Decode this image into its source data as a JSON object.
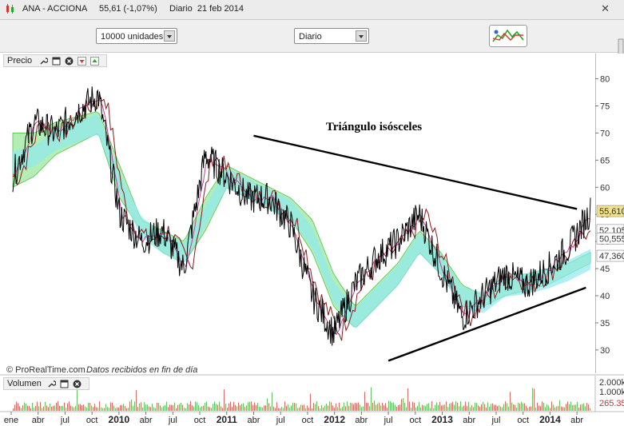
{
  "window": {
    "title": "ANA - ACCIONA     55,61 (-1,07%)     Diario  21 feb 2014"
  },
  "toolbar": {
    "units_select": "10000 unidades",
    "period_select": "Diario"
  },
  "price_panel": {
    "label": "Precio",
    "watermark_brand": "© ProRealTime.com",
    "watermark_note": "Datos recibidos en fin de día",
    "annotation": "Triángulo isósceles",
    "price_tags": [
      {
        "text": "55,610",
        "value": 55.61,
        "color": "#f3e28a"
      },
      {
        "text": "52,105",
        "value": 52.1,
        "color": "#ffffff"
      },
      {
        "text": "50,555",
        "value": 50.55,
        "color": "#ffffff"
      },
      {
        "text": "47,360",
        "value": 47.36,
        "color": "#ffffff"
      }
    ]
  },
  "volume_panel": {
    "label": "Volumen",
    "ticks": [
      "2.000k",
      "1.000k",
      "265.35"
    ]
  },
  "chart_data": {
    "type": "line",
    "title": "",
    "xlabel": "",
    "ylabel": "",
    "ylim": [
      26,
      82
    ],
    "yticks": [
      30,
      35,
      40,
      45,
      50,
      55,
      60,
      65,
      70,
      75,
      80
    ],
    "xticks": [
      {
        "label": "ene",
        "bold": false
      },
      {
        "label": "abr",
        "bold": false
      },
      {
        "label": "jul",
        "bold": false
      },
      {
        "label": "oct",
        "bold": false
      },
      {
        "label": "2010",
        "bold": true
      },
      {
        "label": "abr",
        "bold": false
      },
      {
        "label": "jul",
        "bold": false
      },
      {
        "label": "oct",
        "bold": false
      },
      {
        "label": "2011",
        "bold": true
      },
      {
        "label": "abr",
        "bold": false
      },
      {
        "label": "jul",
        "bold": false
      },
      {
        "label": "oct",
        "bold": false
      },
      {
        "label": "2012",
        "bold": true
      },
      {
        "label": "abr",
        "bold": false
      },
      {
        "label": "jul",
        "bold": false
      },
      {
        "label": "oct",
        "bold": false
      },
      {
        "label": "2013",
        "bold": true
      },
      {
        "label": "abr",
        "bold": false
      },
      {
        "label": "jul",
        "bold": false
      },
      {
        "label": "oct",
        "bold": false
      },
      {
        "label": "2014",
        "bold": true
      },
      {
        "label": "abr",
        "bold": false
      }
    ],
    "x_months": [
      "2009-01",
      "2009-04",
      "2009-07",
      "2009-10",
      "2010-01",
      "2010-04",
      "2010-07",
      "2010-10",
      "2011-01",
      "2011-04",
      "2011-07",
      "2011-10",
      "2012-01",
      "2012-04",
      "2012-07",
      "2012-10",
      "2013-01",
      "2013-04",
      "2013-07",
      "2013-10",
      "2014-01",
      "2014-04"
    ],
    "series": [
      {
        "role": "price",
        "color": "#000000",
        "values": [
          62,
          72,
          70,
          74,
          77,
          55,
          50,
          52,
          45,
          66,
          62,
          58,
          58,
          53,
          40,
          33,
          42,
          47,
          50,
          55,
          45,
          36,
          40,
          44,
          42,
          45,
          49,
          55.6
        ]
      }
    ],
    "cloud_upper": [
      70,
      70,
      72,
      73,
      74,
      64,
      54,
      52,
      50,
      58,
      64,
      62,
      60,
      58,
      54,
      44,
      38,
      42,
      46,
      52,
      48,
      42,
      40,
      44,
      44,
      45,
      46,
      48
    ],
    "cloud_lower": [
      60,
      62,
      66,
      68,
      70,
      58,
      52,
      48,
      46,
      52,
      60,
      58,
      56,
      54,
      48,
      38,
      34,
      38,
      42,
      48,
      44,
      38,
      38,
      40,
      41,
      42,
      44,
      46
    ],
    "triangle": {
      "upper_line": [
        {
          "x": "2011-04",
          "y": 69.5
        },
        {
          "x": "2014-04",
          "y": 56
        }
      ],
      "lower_line": [
        {
          "x": "2012-07",
          "y": 28
        },
        {
          "x": "2014-05",
          "y": 41.5
        }
      ]
    }
  }
}
